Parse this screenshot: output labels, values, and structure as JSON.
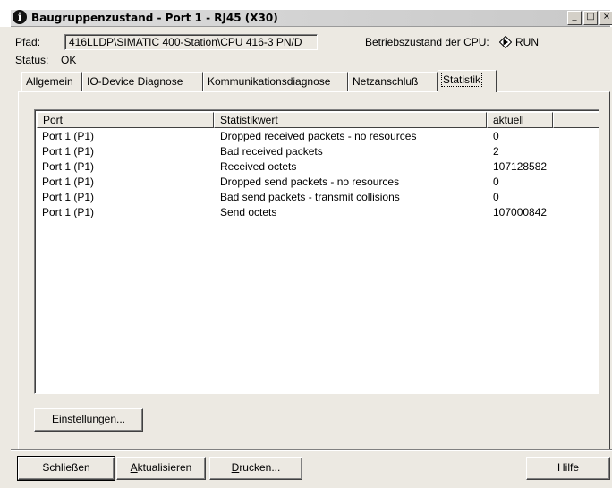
{
  "window": {
    "title": "Baugruppenzustand - Port 1 - RJ45 (X30)",
    "icon": "info-icon",
    "controls": [
      "minimize-icon",
      "maximize-icon",
      "close-icon"
    ]
  },
  "path": {
    "label_key": "P",
    "label_rest": "fad:",
    "value": "416LLDP\\SIMATIC 400-Station\\CPU 416-3 PN/D"
  },
  "cpu": {
    "label": "Betriebszustand der CPU:",
    "icon": "run-state-icon",
    "state": "RUN"
  },
  "status": {
    "label": "Status:",
    "value": "OK"
  },
  "tabs": [
    {
      "label": "Allgemein",
      "active": false
    },
    {
      "label": "IO-Device Diagnose",
      "active": false
    },
    {
      "label": "Kommunikationsdiagnose",
      "active": false
    },
    {
      "label": "Netzanschluß",
      "active": false
    },
    {
      "label": "Statistik",
      "active": true
    }
  ],
  "table": {
    "columns": [
      "Port",
      "Statistikwert",
      "aktuell"
    ],
    "rows": [
      [
        "Port 1 (P1)",
        "Dropped received packets - no resources",
        "0"
      ],
      [
        "Port 1 (P1)",
        "Bad received packets",
        "2"
      ],
      [
        "Port 1 (P1)",
        "Received octets",
        "107128582"
      ],
      [
        "Port 1 (P1)",
        "Dropped send packets - no resources",
        "0"
      ],
      [
        "Port 1 (P1)",
        "Bad send packets - transmit collisions",
        "0"
      ],
      [
        "Port 1 (P1)",
        "Send octets",
        "107000842"
      ]
    ]
  },
  "buttons": {
    "einstellungen_key": "E",
    "einstellungen_rest": "instellungen...",
    "schliessen": "Schließen",
    "aktualisieren_key": "A",
    "aktualisieren_rest": "ktualisieren",
    "drucken_key": "D",
    "drucken_rest": "rucken...",
    "hilfe": "Hilfe"
  }
}
